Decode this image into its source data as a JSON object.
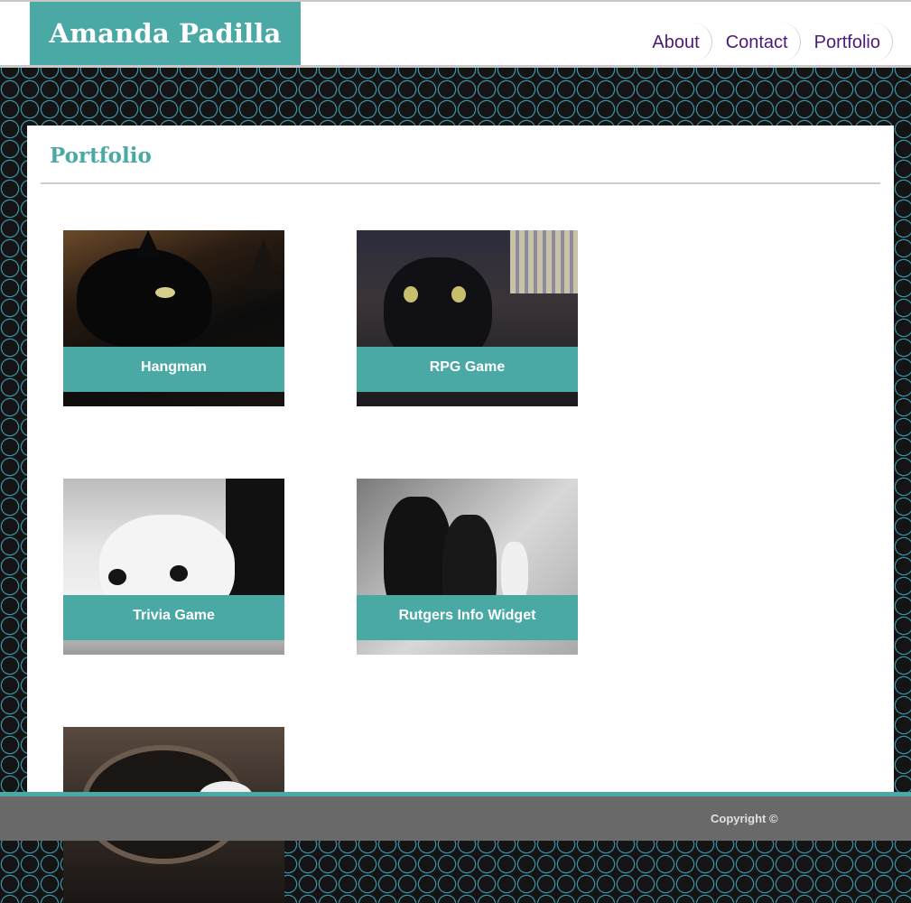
{
  "header": {
    "brand": "Amanda Padilla",
    "nav": [
      "About",
      "Contact",
      "Portfolio"
    ]
  },
  "main": {
    "title": "Portfolio",
    "projects": [
      {
        "label": "Hangman",
        "image": "black-cat-photo"
      },
      {
        "label": "RPG Game",
        "image": "black-cat-photo"
      },
      {
        "label": "Trivia Game",
        "image": "white-kitten-photo"
      },
      {
        "label": "Rutgers Info Widget",
        "image": "two-cats-photo"
      },
      {
        "label": "",
        "image": "cat-photo"
      }
    ]
  },
  "footer": {
    "copyright": "Copyright ©"
  },
  "colors": {
    "accent": "#4aa9a4",
    "nav_link": "#4b1a7a",
    "footer_bg": "#696969"
  }
}
